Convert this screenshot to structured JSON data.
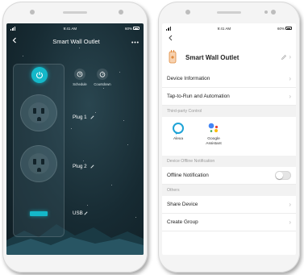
{
  "left_phone": {
    "status": {
      "time": "9:41 AM",
      "battery": "60%"
    },
    "title": "Smart Wall Outlet",
    "controls": {
      "schedule": "Schedule",
      "countdown": "Countdown"
    },
    "plugs": {
      "plug1": "Plug 1",
      "plug2": "Plug 2",
      "usb": "USB"
    },
    "icons": {
      "back": "back-arrow-icon",
      "more": "more-dots-icon",
      "power": "power-icon"
    },
    "colors": {
      "accent": "#14b8c9",
      "background": "#172b33"
    }
  },
  "right_phone": {
    "status": {
      "time": "9:41 AM",
      "battery": "60%"
    },
    "device_name": "Smart Wall Outlet",
    "menu": {
      "device_info": "Device Information",
      "tap_to_run": "Tap-to-Run and Automation"
    },
    "sections": {
      "third_party": "Third-party Control",
      "offline": "Device Offline Notification",
      "others": "Others"
    },
    "third_party": {
      "alexa": "Alexa",
      "google_line1": "Google",
      "google_line2": "Assistant"
    },
    "offline_notification": {
      "label": "Offline Notification",
      "enabled": false
    },
    "others": {
      "share": "Share Device",
      "group": "Create Group"
    },
    "colors": {
      "alexa": "#1fa3d6",
      "google_blue": "#4285f4",
      "google_red": "#ea4335",
      "google_yellow": "#fbbc05",
      "google_green": "#34a853",
      "device_icon": "#e08a3c"
    }
  }
}
